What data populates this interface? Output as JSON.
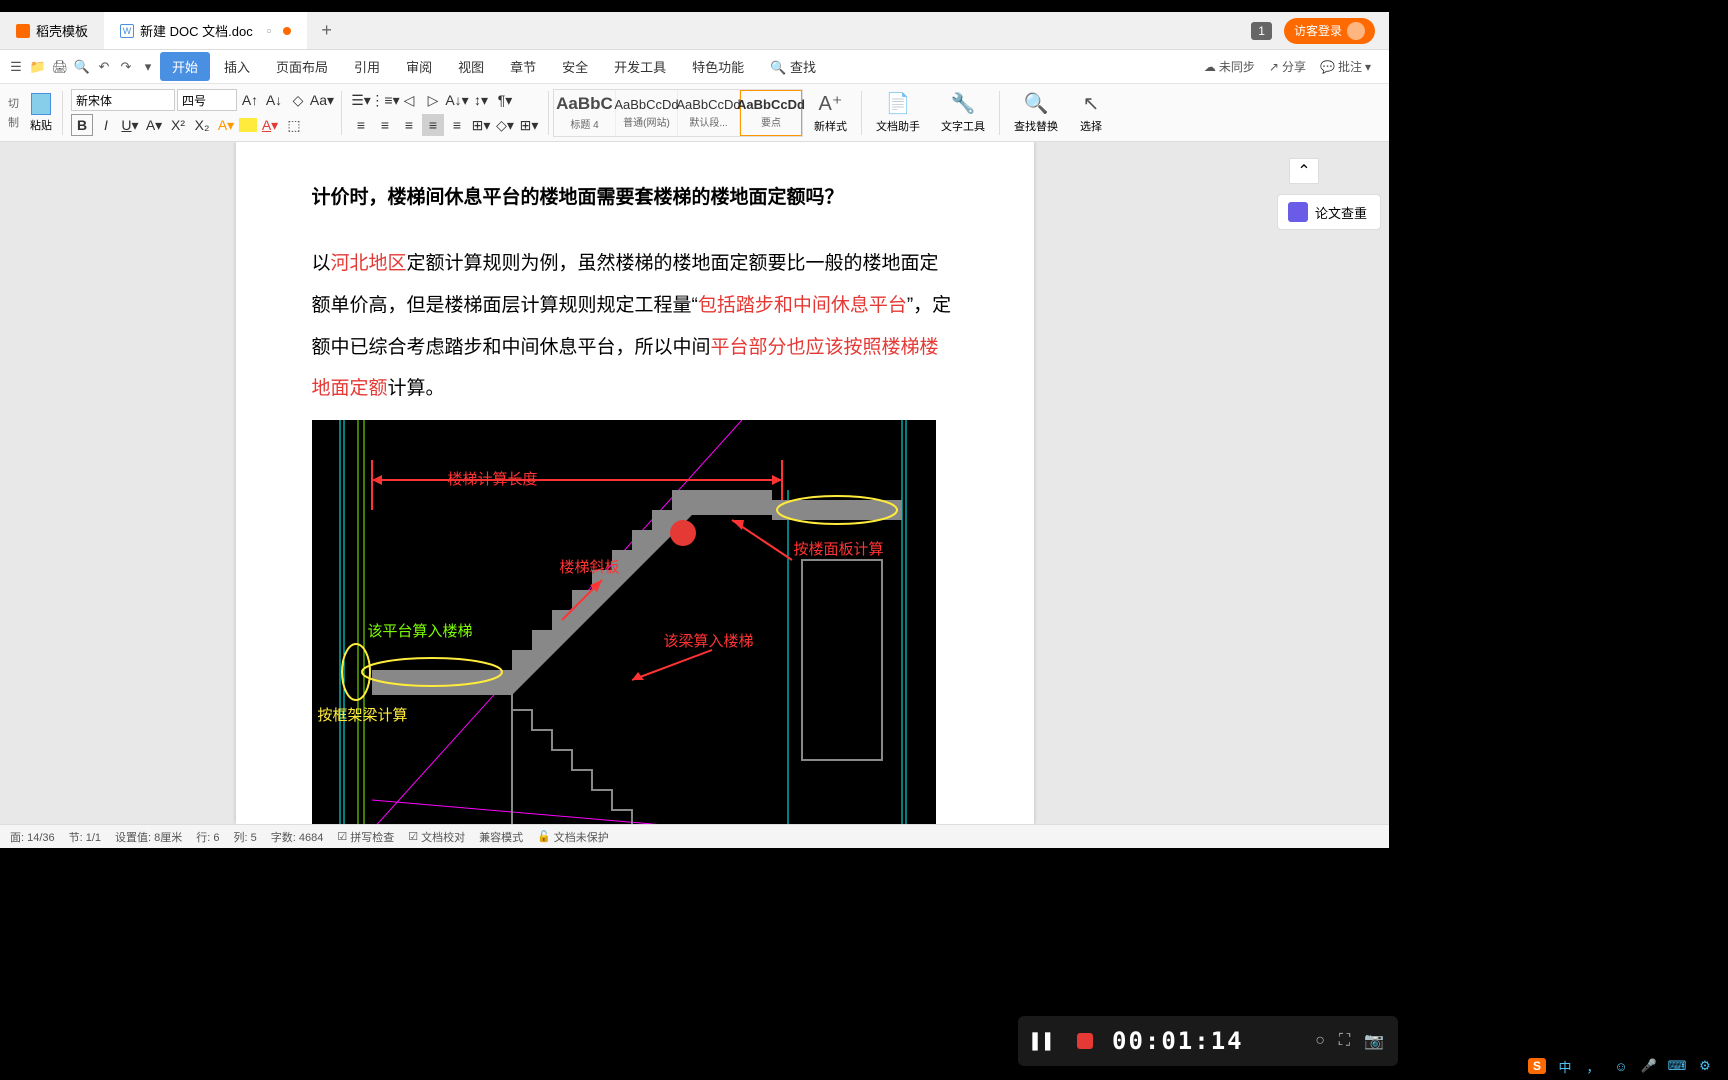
{
  "tabs": {
    "template": "稻壳模板",
    "doc": "新建 DOC 文档.doc"
  },
  "login_btn": "访客登录",
  "tab_badge": "1",
  "menus": {
    "start": "开始",
    "insert": "插入",
    "layout": "页面布局",
    "ref": "引用",
    "review": "审阅",
    "view": "视图",
    "chapter": "章节",
    "security": "安全",
    "dev": "开发工具",
    "special": "特色功能",
    "search": "查找"
  },
  "menu_right": {
    "sync": "未同步",
    "share": "分享",
    "comment": "批注"
  },
  "ribbon": {
    "cut": "切",
    "copy": "制",
    "paste": "粘贴",
    "font_name": "新宋体",
    "font_size": "四号",
    "styles": {
      "heading4": {
        "preview": "AaBbC",
        "label": "标题 4"
      },
      "normal": {
        "preview": "AaBbCcDd",
        "label": "普通(网站)"
      },
      "default": {
        "preview": "AaBbCcDd",
        "label": "默认段..."
      },
      "point": {
        "preview": "AaBbCcDd",
        "label": "要点"
      }
    },
    "new_style": "新样式",
    "doc_helper": "文档助手",
    "text_tool": "文字工具",
    "find_replace": "查找替换",
    "select": "选择"
  },
  "side": {
    "check": "论文查重"
  },
  "doc": {
    "heading": "计价时，楼梯间休息平台的楼地面需要套楼梯的楼地面定额吗？",
    "p1_a": "以",
    "p1_red1": "河北地区",
    "p1_b": "定额计算规则为例，虽然楼梯的楼地面定额要比一般的楼地面定额单价高，但是楼梯面层计算规则规定工程量“",
    "p1_red2": "包括踏步和中间休息平台",
    "p1_c": "”，定额中已综合考虑踏步和中间休息平台，所以中间",
    "p1_red3": "平台部分也应该按照楼梯楼地面定额",
    "p1_d": "计算。"
  },
  "cad": {
    "calc_length": "楼梯计算长度",
    "slab": "楼梯斜板",
    "platform_in": "该平台算入楼梯",
    "beam_in": "该梁算入楼梯",
    "floor_calc": "按楼面板计算",
    "frame_calc": "按框架梁计算"
  },
  "status": {
    "page": "面: 14/36",
    "section": "节: 1/1",
    "setting": "设置值: 8厘米",
    "row": "行: 6",
    "col": "列: 5",
    "words": "字数: 4684",
    "spell": "拼写检查",
    "proof": "文档校对",
    "compat": "兼容模式",
    "unprotect": "文档未保护"
  },
  "recorder": {
    "time": "00:01:14"
  },
  "taskbar": {
    "input": "中"
  }
}
